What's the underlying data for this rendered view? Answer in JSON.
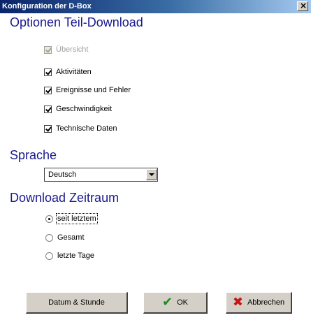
{
  "window": {
    "title": "Konfiguration der D-Box",
    "close_label": "×"
  },
  "sections": {
    "teil_download": "Optionen Teil-Download",
    "sprache": "Sprache",
    "zeitraum": "Download Zeitraum"
  },
  "checkboxes": [
    {
      "label": "Übersicht",
      "checked": true,
      "disabled": true
    },
    {
      "label": "Aktivitäten",
      "checked": true,
      "disabled": false
    },
    {
      "label": "Ereignisse und Fehler",
      "checked": true,
      "disabled": false
    },
    {
      "label": "Geschwindigkeit",
      "checked": true,
      "disabled": false
    },
    {
      "label": "Technische Daten",
      "checked": true,
      "disabled": false
    }
  ],
  "language": {
    "value": "Deutsch"
  },
  "radios": [
    {
      "label": "seit letztem",
      "checked": true
    },
    {
      "label": "Gesamt",
      "checked": false
    },
    {
      "label": "letzte Tage",
      "checked": false
    }
  ],
  "buttons": {
    "datum": "Datum & Stunde",
    "ok": "OK",
    "abbrechen": "Abbrechen"
  },
  "icons": {
    "ok_icon": "check-icon",
    "cancel_icon": "x-icon",
    "ok_color": "#1e8c1e",
    "cancel_color": "#c81414"
  }
}
